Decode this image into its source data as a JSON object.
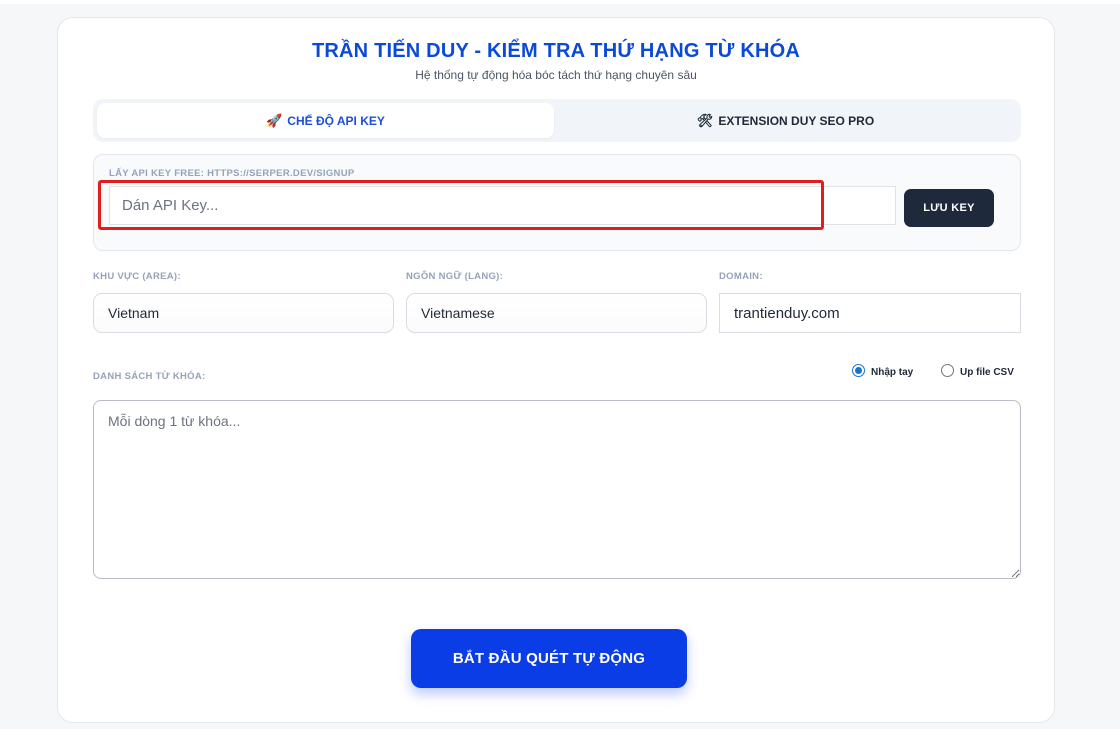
{
  "header": {
    "title": "TRẦN TIẾN DUY - KIỂM TRA THỨ HẠNG TỪ KHÓA",
    "subtitle": "Hệ thống tự động hóa bóc tách thứ hạng chuyên sâu"
  },
  "tabs": [
    {
      "label": "CHẾ ĐỘ API KEY",
      "icon": "rocket-icon",
      "glyph": "🚀",
      "active": true
    },
    {
      "label": "EXTENSION DUY SEO PRO",
      "icon": "tools-icon",
      "glyph": "🛠",
      "active": false
    }
  ],
  "api": {
    "label": "LẤY API KEY FREE: HTTPS://SERPER.DEV/SIGNUP",
    "placeholder": "Dán API Key...",
    "save_label": "LƯU KEY"
  },
  "fields": {
    "area": {
      "label": "KHU VỰC (AREA):",
      "value": "Vietnam"
    },
    "lang": {
      "label": "NGÔN NGỮ (LANG):",
      "value": "Vietnamese"
    },
    "domain": {
      "label": "DOMAIN:",
      "value": "trantienduy.com"
    }
  },
  "keywords": {
    "label": "DANH SÁCH TỪ KHÓA:",
    "placeholder": "Mỗi dòng 1 từ khóa...",
    "modes": [
      {
        "label": "Nhập tay",
        "checked": true
      },
      {
        "label": "Up file CSV",
        "checked": false
      }
    ]
  },
  "actions": {
    "start_label": "BẮT ĐẦU QUÉT TỰ ĐỘNG"
  },
  "colors": {
    "title": "#0b49d8",
    "subtitle": "#4b5563",
    "tab_active_text": "#1d4ed8",
    "tab_text": "#1f2937",
    "label": "#94a3b8",
    "save_button_bg": "#1e293b",
    "start_button_bg": "#0b3de6",
    "highlight": "#e11d1d"
  }
}
